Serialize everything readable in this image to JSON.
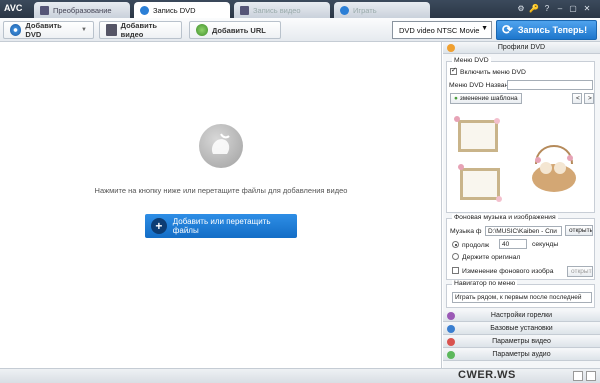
{
  "app": {
    "name": "AVC"
  },
  "tabs": [
    {
      "label": "Преобразование",
      "state": "inactive"
    },
    {
      "label": "Запись DVD",
      "state": "active"
    },
    {
      "label": "Запись видео",
      "state": "dim"
    },
    {
      "label": "Играть",
      "state": "dim"
    }
  ],
  "window_controls": {
    "settings": "⚙",
    "key": "🔑",
    "help": "?",
    "minimize": "–",
    "maximize": "▢",
    "close": "✕"
  },
  "toolbar": {
    "add_dvd": "Добавить DVD",
    "add_video": "Добавить видео",
    "add_url": "Добавить URL",
    "format_select": "DVD video NTSC Movie",
    "burn_button": "Запись Теперь!"
  },
  "main": {
    "drop_hint": "Нажмите на кнопку ниже или перетащите файлы для добавления видео",
    "add_button": "Добавить или перетащить файлы"
  },
  "panel": {
    "profiles_header": "Профили DVD",
    "dvd_menu": {
      "group_title": "Меню DVD",
      "enable_label": "Включить меню DVD",
      "enable_checked": true,
      "name_label": "Меню DVD Назван",
      "name_value": "",
      "change_template": "зменение шаблона",
      "prev": "<",
      "next": ">"
    },
    "music": {
      "group_title": "Фоновая музыка и изображения",
      "music_label": "Музыка ф",
      "music_path": "D:\\MUSIC\\Kaiben - Спи",
      "open_button": "открыть",
      "duration_label": "продолж",
      "duration_value": "40",
      "seconds_label": "секунды",
      "duration_selected": true,
      "keep_original_label": "Держите оригинал",
      "keep_original_selected": false,
      "change_bg_label": "Изменение фонового изобра",
      "change_bg_checked": false,
      "open_button_2": "открыть"
    },
    "navigator": {
      "group_title": "Навигатор по меню",
      "value": "Играть рядом, к первым после последней"
    },
    "sections": [
      {
        "label": "Настройки горелки",
        "color": "#9b59b6"
      },
      {
        "label": "Базовые установки",
        "color": "#3b7fd0"
      },
      {
        "label": "Параметры видео",
        "color": "#d9534f"
      },
      {
        "label": "Параметры аудио",
        "color": "#5cb85c"
      }
    ]
  },
  "watermark": {
    "text": "CWER.WS"
  },
  "colors": {
    "accent": "#1d76cc",
    "titlebar": "#2b3645"
  }
}
